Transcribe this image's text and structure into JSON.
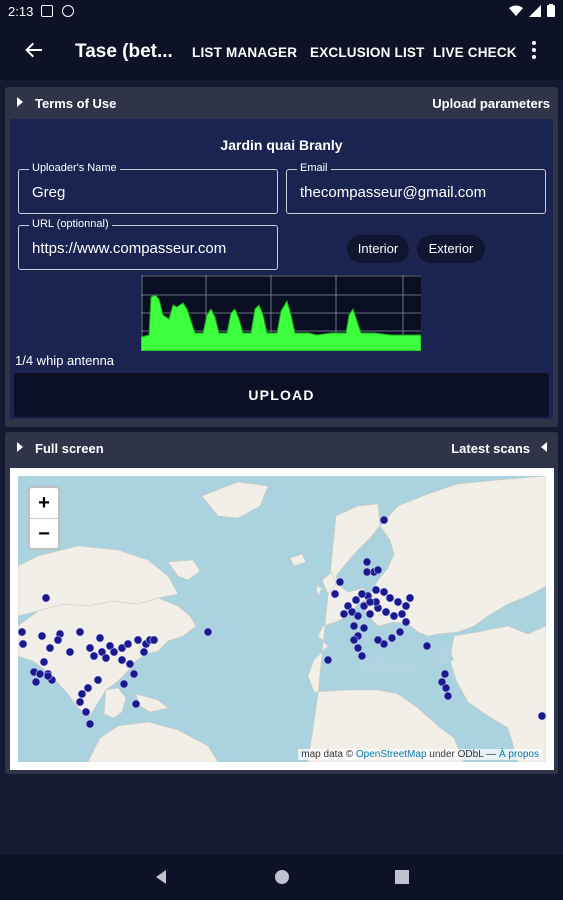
{
  "status": {
    "time": "2:13",
    "icons": [
      "rectangle-icon",
      "at-icon",
      "wifi-icon",
      "signal-icon",
      "battery-icon"
    ]
  },
  "appbar": {
    "title": "Tase (bet...",
    "actions": [
      "LIST MANAGER",
      "EXCLUSION LIST",
      "LIVE CHECK"
    ],
    "back_icon": "back-arrow-icon",
    "more_icon": "more-vertical-icon"
  },
  "upload_section": {
    "header_left": "Terms of Use",
    "header_right": "Upload parameters",
    "location": "Jardin quai Branly",
    "name_label": "Uploader's Name",
    "name_value": "Greg",
    "email_label": "Email",
    "email_value": "thecompasseur@gmail.com",
    "url_label": "URL (optionnal)",
    "url_value": "https://www.compasseur.com",
    "chip_interior": "Interior",
    "chip_exterior": "Exterior",
    "antenna": "1/4 whip antenna",
    "upload_button": "UPLOAD"
  },
  "map_section": {
    "header_left": "Full screen",
    "header_right": "Latest scans",
    "zoom_in": "+",
    "zoom_out": "−",
    "attribution_prefix": "map data ©",
    "attribution_osm": "OpenStreetMap",
    "attribution_mid": "under ODbL —",
    "attribution_link": "À propos"
  },
  "colors": {
    "background": "#151a33",
    "panel": "#1b2450",
    "spectrum": "#3dff3d",
    "marker": "#1a1a8c",
    "sea": "#aad3df",
    "land": "#f2efe9"
  }
}
